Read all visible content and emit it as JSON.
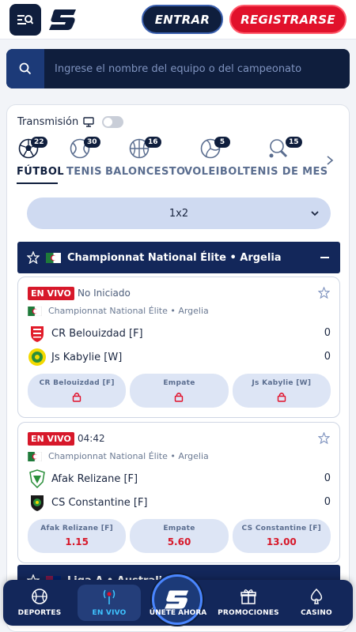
{
  "header": {
    "login_label": "ENTRAR",
    "register_label": "REGISTRARSE"
  },
  "search": {
    "placeholder": "Ingrese el nombre del equipo o del campeonato"
  },
  "transmission": {
    "label": "Transmisión",
    "enabled": false
  },
  "sports": [
    {
      "label": "FÚTBOL",
      "count": "22",
      "icon": "soccer-ball-icon",
      "active": true
    },
    {
      "label": "TENIS",
      "count": "30",
      "icon": "tennis-ball-icon",
      "active": false
    },
    {
      "label": "BALONCESTO",
      "count": "16",
      "icon": "basketball-icon",
      "active": false
    },
    {
      "label": "VOLEIBOL",
      "count": "5",
      "icon": "volleyball-icon",
      "active": false
    },
    {
      "label": "TENIS DE MES",
      "count": "15",
      "icon": "table-tennis-icon",
      "active": false
    }
  ],
  "market": {
    "selected": "1x2"
  },
  "league": {
    "title": "Championnat National Élite • Argelia"
  },
  "matches": [
    {
      "live_label": "EN VIVO",
      "status": "No Iniciado",
      "league": "Championnat National Élite • Argelia",
      "home": {
        "name": "CR Belouizdad [F]",
        "score": "0"
      },
      "away": {
        "name": "Js Kabylie [W]",
        "score": "0"
      },
      "odds": [
        {
          "label": "CR Belouizdad [F]",
          "value": "",
          "locked": true
        },
        {
          "label": "Empate",
          "value": "",
          "locked": true
        },
        {
          "label": "Js Kabylie [W]",
          "value": "",
          "locked": true
        }
      ]
    },
    {
      "live_label": "EN VIVO",
      "status": "04:42",
      "league": "Championnat National Élite • Argelia",
      "home": {
        "name": "Afak Relizane [F]",
        "score": "0"
      },
      "away": {
        "name": "CS Constantine [F]",
        "score": "0"
      },
      "odds": [
        {
          "label": "Afak Relizane [F]",
          "value": "1.15",
          "locked": false
        },
        {
          "label": "Empate",
          "value": "5.60",
          "locked": false
        },
        {
          "label": "CS Constantine [F]",
          "value": "13.00",
          "locked": false
        }
      ]
    }
  ],
  "league2": {
    "title": "Liga A • Australia"
  },
  "bottom_nav": {
    "sports_label": "DEPORTES",
    "live_label": "EN VIVO",
    "join_label": "ÚNETE AHORA",
    "promos_label": "PROMOCIONES",
    "casino_label": "CASINO"
  },
  "colors": {
    "navy": "#0f1e3d",
    "accent_blue": "#13275a",
    "red": "#e1112b",
    "live_cyan": "#3ec4ff"
  }
}
